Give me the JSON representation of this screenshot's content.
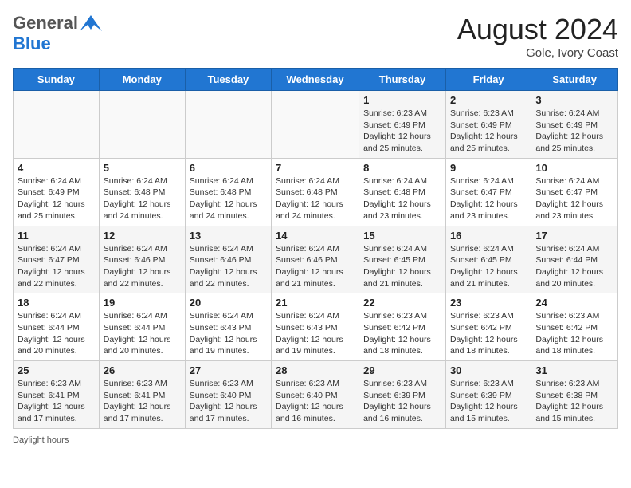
{
  "header": {
    "logo_general": "General",
    "logo_blue": "Blue",
    "month_year": "August 2024",
    "location": "Gole, Ivory Coast"
  },
  "days_of_week": [
    "Sunday",
    "Monday",
    "Tuesday",
    "Wednesday",
    "Thursday",
    "Friday",
    "Saturday"
  ],
  "weeks": [
    [
      {
        "day": "",
        "info": ""
      },
      {
        "day": "",
        "info": ""
      },
      {
        "day": "",
        "info": ""
      },
      {
        "day": "",
        "info": ""
      },
      {
        "day": "1",
        "info": "Sunrise: 6:23 AM\nSunset: 6:49 PM\nDaylight: 12 hours\nand 25 minutes."
      },
      {
        "day": "2",
        "info": "Sunrise: 6:23 AM\nSunset: 6:49 PM\nDaylight: 12 hours\nand 25 minutes."
      },
      {
        "day": "3",
        "info": "Sunrise: 6:24 AM\nSunset: 6:49 PM\nDaylight: 12 hours\nand 25 minutes."
      }
    ],
    [
      {
        "day": "4",
        "info": "Sunrise: 6:24 AM\nSunset: 6:49 PM\nDaylight: 12 hours\nand 25 minutes."
      },
      {
        "day": "5",
        "info": "Sunrise: 6:24 AM\nSunset: 6:48 PM\nDaylight: 12 hours\nand 24 minutes."
      },
      {
        "day": "6",
        "info": "Sunrise: 6:24 AM\nSunset: 6:48 PM\nDaylight: 12 hours\nand 24 minutes."
      },
      {
        "day": "7",
        "info": "Sunrise: 6:24 AM\nSunset: 6:48 PM\nDaylight: 12 hours\nand 24 minutes."
      },
      {
        "day": "8",
        "info": "Sunrise: 6:24 AM\nSunset: 6:48 PM\nDaylight: 12 hours\nand 23 minutes."
      },
      {
        "day": "9",
        "info": "Sunrise: 6:24 AM\nSunset: 6:47 PM\nDaylight: 12 hours\nand 23 minutes."
      },
      {
        "day": "10",
        "info": "Sunrise: 6:24 AM\nSunset: 6:47 PM\nDaylight: 12 hours\nand 23 minutes."
      }
    ],
    [
      {
        "day": "11",
        "info": "Sunrise: 6:24 AM\nSunset: 6:47 PM\nDaylight: 12 hours\nand 22 minutes."
      },
      {
        "day": "12",
        "info": "Sunrise: 6:24 AM\nSunset: 6:46 PM\nDaylight: 12 hours\nand 22 minutes."
      },
      {
        "day": "13",
        "info": "Sunrise: 6:24 AM\nSunset: 6:46 PM\nDaylight: 12 hours\nand 22 minutes."
      },
      {
        "day": "14",
        "info": "Sunrise: 6:24 AM\nSunset: 6:46 PM\nDaylight: 12 hours\nand 21 minutes."
      },
      {
        "day": "15",
        "info": "Sunrise: 6:24 AM\nSunset: 6:45 PM\nDaylight: 12 hours\nand 21 minutes."
      },
      {
        "day": "16",
        "info": "Sunrise: 6:24 AM\nSunset: 6:45 PM\nDaylight: 12 hours\nand 21 minutes."
      },
      {
        "day": "17",
        "info": "Sunrise: 6:24 AM\nSunset: 6:44 PM\nDaylight: 12 hours\nand 20 minutes."
      }
    ],
    [
      {
        "day": "18",
        "info": "Sunrise: 6:24 AM\nSunset: 6:44 PM\nDaylight: 12 hours\nand 20 minutes."
      },
      {
        "day": "19",
        "info": "Sunrise: 6:24 AM\nSunset: 6:44 PM\nDaylight: 12 hours\nand 20 minutes."
      },
      {
        "day": "20",
        "info": "Sunrise: 6:24 AM\nSunset: 6:43 PM\nDaylight: 12 hours\nand 19 minutes."
      },
      {
        "day": "21",
        "info": "Sunrise: 6:24 AM\nSunset: 6:43 PM\nDaylight: 12 hours\nand 19 minutes."
      },
      {
        "day": "22",
        "info": "Sunrise: 6:23 AM\nSunset: 6:42 PM\nDaylight: 12 hours\nand 18 minutes."
      },
      {
        "day": "23",
        "info": "Sunrise: 6:23 AM\nSunset: 6:42 PM\nDaylight: 12 hours\nand 18 minutes."
      },
      {
        "day": "24",
        "info": "Sunrise: 6:23 AM\nSunset: 6:42 PM\nDaylight: 12 hours\nand 18 minutes."
      }
    ],
    [
      {
        "day": "25",
        "info": "Sunrise: 6:23 AM\nSunset: 6:41 PM\nDaylight: 12 hours\nand 17 minutes."
      },
      {
        "day": "26",
        "info": "Sunrise: 6:23 AM\nSunset: 6:41 PM\nDaylight: 12 hours\nand 17 minutes."
      },
      {
        "day": "27",
        "info": "Sunrise: 6:23 AM\nSunset: 6:40 PM\nDaylight: 12 hours\nand 17 minutes."
      },
      {
        "day": "28",
        "info": "Sunrise: 6:23 AM\nSunset: 6:40 PM\nDaylight: 12 hours\nand 16 minutes."
      },
      {
        "day": "29",
        "info": "Sunrise: 6:23 AM\nSunset: 6:39 PM\nDaylight: 12 hours\nand 16 minutes."
      },
      {
        "day": "30",
        "info": "Sunrise: 6:23 AM\nSunset: 6:39 PM\nDaylight: 12 hours\nand 15 minutes."
      },
      {
        "day": "31",
        "info": "Sunrise: 6:23 AM\nSunset: 6:38 PM\nDaylight: 12 hours\nand 15 minutes."
      }
    ]
  ],
  "footer": {
    "daylight_hours": "Daylight hours"
  }
}
